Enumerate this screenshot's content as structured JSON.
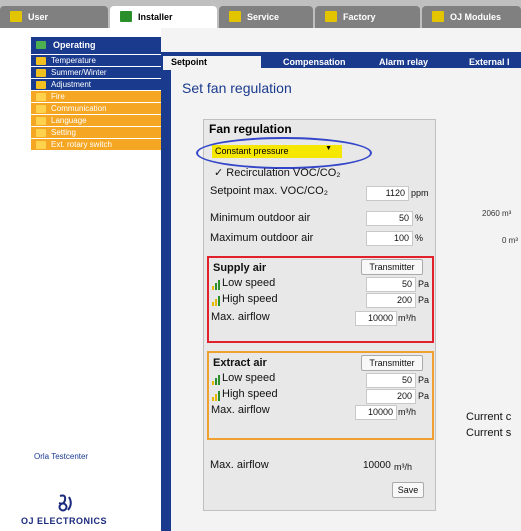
{
  "top_tabs": [
    {
      "label": "User",
      "active": false
    },
    {
      "label": "Installer",
      "active": true
    },
    {
      "label": "Service",
      "active": false
    },
    {
      "label": "Factory",
      "active": false
    },
    {
      "label": "OJ Modules",
      "active": false
    }
  ],
  "nav": {
    "header": "Operating",
    "items": [
      {
        "label": "Temperature",
        "color": "blue"
      },
      {
        "label": "Summer/Winter",
        "color": "blue"
      },
      {
        "label": "Adjustment",
        "color": "blue"
      },
      {
        "label": "Fire",
        "color": "orange"
      },
      {
        "label": "Communication",
        "color": "orange"
      },
      {
        "label": "Language",
        "color": "orange"
      },
      {
        "label": "Setting",
        "color": "orange"
      },
      {
        "label": "Ext. rotary switch",
        "color": "orange"
      }
    ]
  },
  "footer": {
    "testcenter": "Orla Testcenter",
    "logo_text": "OJ ELECTRONICS"
  },
  "sub_tabs": [
    {
      "label": "Setpoint",
      "active": true
    },
    {
      "label": "Compensation",
      "active": false
    },
    {
      "label": "Alarm relay",
      "active": false
    },
    {
      "label": "External I",
      "active": false
    }
  ],
  "page_title": "Set fan regulation",
  "fan_regulation": {
    "heading": "Fan regulation",
    "mode_selected": "Constant pressure",
    "recirculation_label": "✓ Recirculation VOC/CO₂",
    "setpoint_label": "Setpoint max. VOC/CO₂",
    "setpoint_value": "1120",
    "setpoint_unit": "ppm",
    "min_outdoor_label": "Minimum outdoor air",
    "min_outdoor_value": "50",
    "max_outdoor_label": "Maximum outdoor air",
    "max_outdoor_value": "100",
    "percent_unit": "%"
  },
  "supply_air": {
    "heading": "Supply air",
    "transmitter_label": "Transmitter",
    "low_label": "Low speed",
    "low_value": "50",
    "high_label": "High speed",
    "high_value": "200",
    "pa_unit": "Pa",
    "airflow_label": "Max. airflow",
    "airflow_value": "10000",
    "airflow_unit": "m³/h"
  },
  "extract_air": {
    "heading": "Extract air",
    "transmitter_label": "Transmitter",
    "low_label": "Low speed",
    "low_value": "50",
    "high_label": "High speed",
    "high_value": "200",
    "pa_unit": "Pa",
    "airflow_label": "Max. airflow",
    "airflow_value": "10000",
    "airflow_unit": "m³/h"
  },
  "total": {
    "airflow_label": "Max. airflow",
    "airflow_value": "10000",
    "airflow_unit": "m³/h",
    "save_label": "Save"
  },
  "right_side": {
    "flow_top": "2060 m³",
    "flow_bottom": "0 m³",
    "current_1": "Current c",
    "current_2": "Current s"
  },
  "colors": {
    "nav_blue": "#1a3a8e",
    "nav_orange": "#f5a623",
    "dropdown_yellow": "#f6e700",
    "supply_border": "#e0202a",
    "extract_border": "#f0a030",
    "highlight_ellipse": "#3345c8"
  }
}
